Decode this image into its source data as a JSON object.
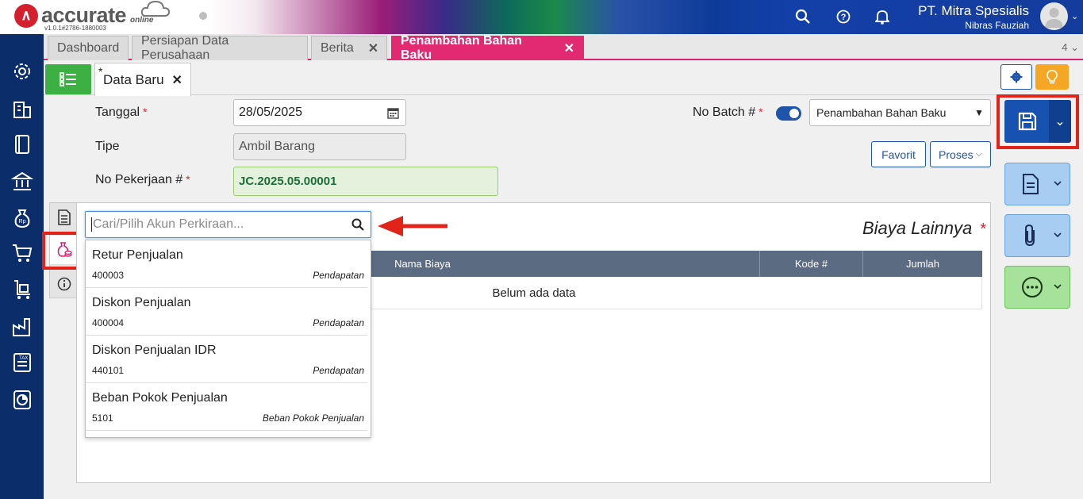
{
  "app": {
    "logo_text": "accurate",
    "logo_sub": "online",
    "version": "v1.0.1#2786-1880003",
    "company": "PT. Mitra Spesialis",
    "user": "Nibras Fauziah"
  },
  "tabs": {
    "items": [
      {
        "label": "Dashboard"
      },
      {
        "label": "Persiapan Data Perusahaan"
      },
      {
        "label": "Berita"
      },
      {
        "label": "Penambahan Bahan Baku"
      }
    ],
    "count": "4"
  },
  "subtab": {
    "label": "Data Baru",
    "marker": "*"
  },
  "form": {
    "tanggal_label": "Tanggal",
    "tanggal_value": "28/05/2025",
    "tipe_label": "Tipe",
    "tipe_value": "Ambil Barang",
    "nopekerjaan_label": "No Pekerjaan #",
    "nopekerjaan_value": "JC.2025.05.00001",
    "nobatch_label": "No Batch #",
    "batch_select": "Penambahan Bahan Baku",
    "required_mark": "*"
  },
  "buttons": {
    "favorit": "Favorit",
    "proses": "Proses"
  },
  "panel": {
    "title": "Biaya Lainnya",
    "columns": [
      "Nama Biaya",
      "Kode #",
      "Jumlah"
    ],
    "empty": "Belum ada data"
  },
  "search": {
    "placeholder": "Cari/Pilih Akun Perkiraan...",
    "results": [
      {
        "name": "Retur Penjualan",
        "code": "400003",
        "type": "Pendapatan"
      },
      {
        "name": "Diskon Penjualan",
        "code": "400004",
        "type": "Pendapatan"
      },
      {
        "name": "Diskon Penjualan IDR",
        "code": "440101",
        "type": "Pendapatan"
      },
      {
        "name": "Beban Pokok Penjualan",
        "code": "5101",
        "type": "Beban Pokok Penjualan"
      }
    ]
  },
  "colors": {
    "accent": "#e12a6f",
    "primary": "#1752b0",
    "sidebar": "#0b2e6b",
    "highlight": "#e2231a"
  }
}
